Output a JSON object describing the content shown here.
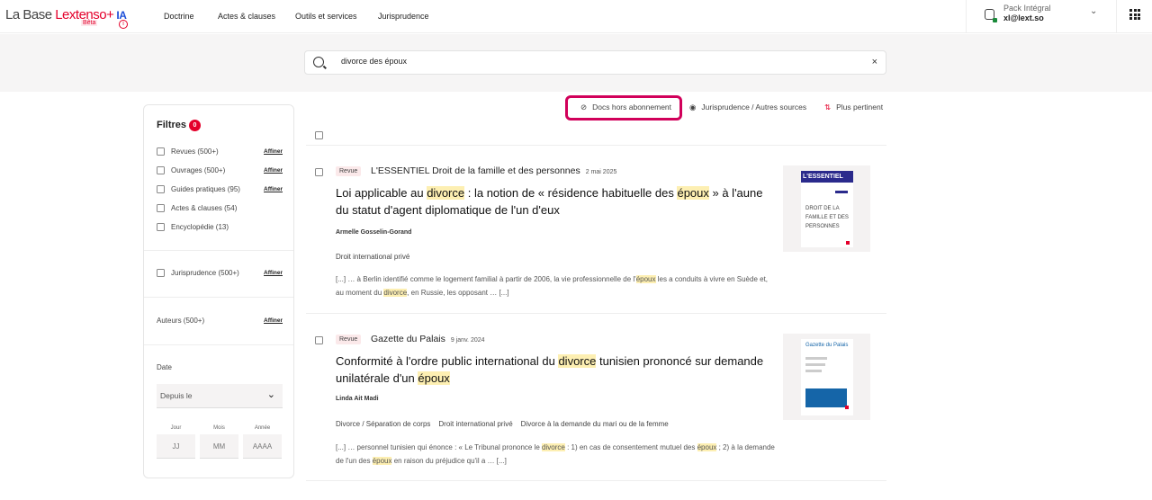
{
  "header": {
    "logo_base": "La Base ",
    "logo_brand": "Lextenso+",
    "logo_ia": "IA",
    "beta": "Bêta",
    "info_icon": "i",
    "nav": [
      "Doctrine",
      "Actes & clauses",
      "Outils et services",
      "Jurisprudence"
    ],
    "account": {
      "plan": "Pack Intégral",
      "email": "xl@lext.so"
    }
  },
  "search": {
    "value": "divorce des époux",
    "clear": "×"
  },
  "filters": {
    "title": "Filtres",
    "count": "0",
    "affiner": "Affiner",
    "types": [
      {
        "label": "Revues (500+)",
        "affiner": true
      },
      {
        "label": "Ouvrages (500+)",
        "affiner": true
      },
      {
        "label": "Guides pratiques (95)",
        "affiner": true
      },
      {
        "label": "Actes & clauses (54)",
        "affiner": false
      },
      {
        "label": "Encyclopédie (13)",
        "affiner": false
      }
    ],
    "jurisprudence": "Jurisprudence (500+)",
    "authors": "Auteurs (500+)",
    "date": {
      "label": "Date",
      "select": "Depuis le",
      "day_label": "Jour",
      "month_label": "Mois",
      "year_label": "Année",
      "day": "JJ",
      "month": "MM",
      "year": "AAAA"
    }
  },
  "toolbar": {
    "docs": "Docs hors abonnement",
    "juris": "Jurisprudence / Autres sources",
    "sort": "Plus pertinent"
  },
  "results": [
    {
      "type": "Revue",
      "source": "L'ESSENTIEL Droit de la famille et des personnes",
      "date": "2 mai 2025",
      "title": [
        {
          "t": "Loi applicable au ",
          "hl": false
        },
        {
          "t": "divorce",
          "hl": true
        },
        {
          "t": " : la notion de « résidence habituelle des ",
          "hl": false
        },
        {
          "t": "époux",
          "hl": true
        },
        {
          "t": " » à l'aune du statut d'agent diplomatique de l'un d'eux",
          "hl": false
        }
      ],
      "author": "Armelle Gosselin-Gorand",
      "categories": [
        "Droit international privé"
      ],
      "excerpt": [
        {
          "t": "[...] … à Berlin identifié comme le logement familial à partir de 2006, la vie professionnelle de l'",
          "hl": false
        },
        {
          "t": "époux",
          "hl": true
        },
        {
          "t": " les a conduits à vivre en Suède et, au moment du ",
          "hl": false
        },
        {
          "t": "divorce",
          "hl": true
        },
        {
          "t": ", en Russie, les opposant … [...]",
          "hl": false
        }
      ],
      "cover": {
        "brand": "L'ESSENTIEL",
        "subtitle": "DROIT DE LA FAMILLE ET DES PERSONNES",
        "color": "#2a2a8c"
      }
    },
    {
      "type": "Revue",
      "source": "Gazette du Palais",
      "date": "9 janv. 2024",
      "title": [
        {
          "t": "Conformité à l'ordre public international du ",
          "hl": false
        },
        {
          "t": "divorce",
          "hl": true
        },
        {
          "t": " tunisien prononcé sur demande unilatérale d'un ",
          "hl": false
        },
        {
          "t": "époux",
          "hl": true
        }
      ],
      "author": "Linda Ait Madi",
      "categories": [
        "Divorce / Séparation de corps",
        "Droit international privé",
        "Divorce à la demande du mari ou de la femme"
      ],
      "excerpt": [
        {
          "t": "[...] … personnel tunisien qui énonce : « Le Tribunal prononce le ",
          "hl": false
        },
        {
          "t": "divorce",
          "hl": true
        },
        {
          "t": " : 1) en cas de consentement mutuel des ",
          "hl": false
        },
        {
          "t": "époux",
          "hl": true
        },
        {
          "t": " ; 2) à la demande de l'un des ",
          "hl": false
        },
        {
          "t": "époux",
          "hl": true
        },
        {
          "t": " en raison du préjudice qu'il a … [...]",
          "hl": false
        }
      ],
      "cover": {
        "brand": "Gazette du Palais",
        "color": "#1565a8"
      }
    }
  ],
  "colors": {
    "accent": "#e4002b",
    "highlight": "#fdefb2",
    "frame": "#d1005a"
  }
}
